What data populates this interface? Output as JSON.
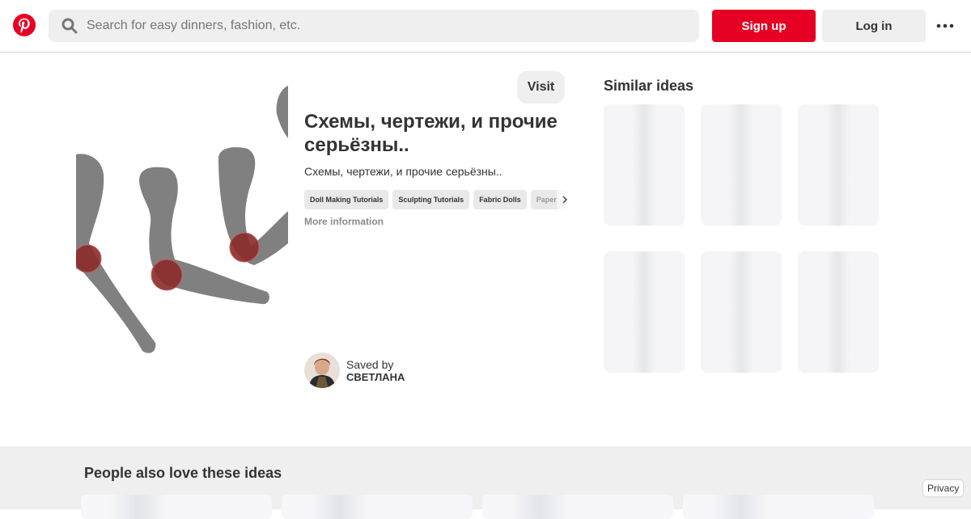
{
  "header": {
    "logo_icon": "pinterest-logo",
    "search_placeholder": "Search for easy dinners, fashion, etc.",
    "signup_label": "Sign up",
    "login_label": "Log in",
    "more_icon": "ellipsis-icon"
  },
  "pin": {
    "visit_label": "Visit",
    "title": "Схемы, чертежи, и прочие серьёзны..",
    "description": "Схемы, чертежи, и прочие серьёзны..",
    "tags": [
      "Doll Making Tutorials",
      "Sculpting Tutorials",
      "Fabric Dolls",
      "Paper"
    ],
    "more_info": "More information",
    "saved_by_label": "Saved by",
    "saver_name": "СВЕТЛАНА"
  },
  "similar": {
    "title": "Similar ideas"
  },
  "bottom": {
    "title": "People also love these ideas",
    "privacy_label": "Privacy"
  },
  "colors": {
    "brand_red": "#e60023",
    "button_gray": "#efefef"
  }
}
